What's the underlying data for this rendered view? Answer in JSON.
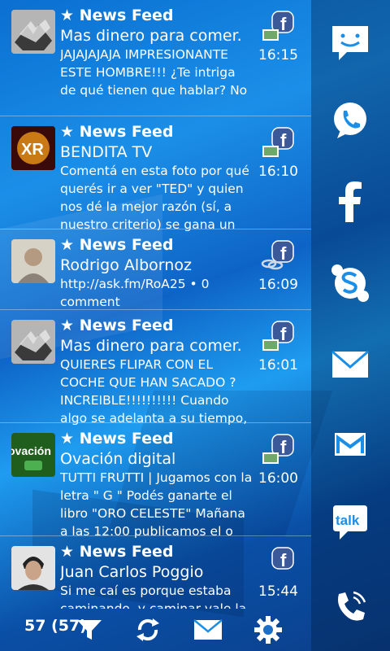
{
  "feed": {
    "items": [
      {
        "header": "★ News Feed",
        "title": "Mas dinero para comer.",
        "body": "JAJAJAJAJA IMPRESIONANTE ESTE HOMBRE!!! ¿Te intriga de qué tienen que hablar? No te",
        "time": "16:15",
        "avatar": "hands-avatar",
        "badge": "photo-badge"
      },
      {
        "header": "★ News Feed",
        "title": "BENDITA TV",
        "body": "Comentá en esta foto por qué querés ir a ver \"TED\" y quien nos dé la mejor razón (sí, a nuestro criterio) se gana un",
        "time": "16:10",
        "avatar": "xr-logo-avatar",
        "badge": "photo-badge"
      },
      {
        "header": "★ News Feed",
        "title": "Rodrigo Albornoz",
        "body": "http://ask.fm/RoA25 • 0 comment",
        "time": "16:09",
        "avatar": "person-avatar",
        "badge": "link-badge"
      },
      {
        "header": "★ News Feed",
        "title": "Mas dinero para comer.",
        "body": "QUIERES FLIPAR CON EL COCHE QUE HAN SACADO ? INCREIBLE!!!!!!!!!! Cuando algo se adelanta a su tiempo,",
        "time": "16:01",
        "avatar": "hands-avatar",
        "badge": "photo-badge"
      },
      {
        "header": "★ News Feed",
        "title": "Ovación digital",
        "body": "TUTTI FRUTTI | Jugamos con la letra \" G \" Podés ganarte el libro \"ORO CELESTE\" Mañana a las 12:00 publicamos el o",
        "time": "16:00",
        "avatar": "ovacion-logo-avatar",
        "avatar_text": "ovación",
        "badge": "photo-badge"
      },
      {
        "header": "★ News Feed",
        "title": "Juan Carlos Poggio",
        "body": "Si me caí es porque estaba caminando, y caminar vale la",
        "time": "15:44",
        "avatar": "portrait-avatar",
        "badge": "none"
      }
    ]
  },
  "bottombar": {
    "count": "57 (57)"
  },
  "colors": {
    "facebook": "#3b5998",
    "accent": "#1b8fe8"
  }
}
